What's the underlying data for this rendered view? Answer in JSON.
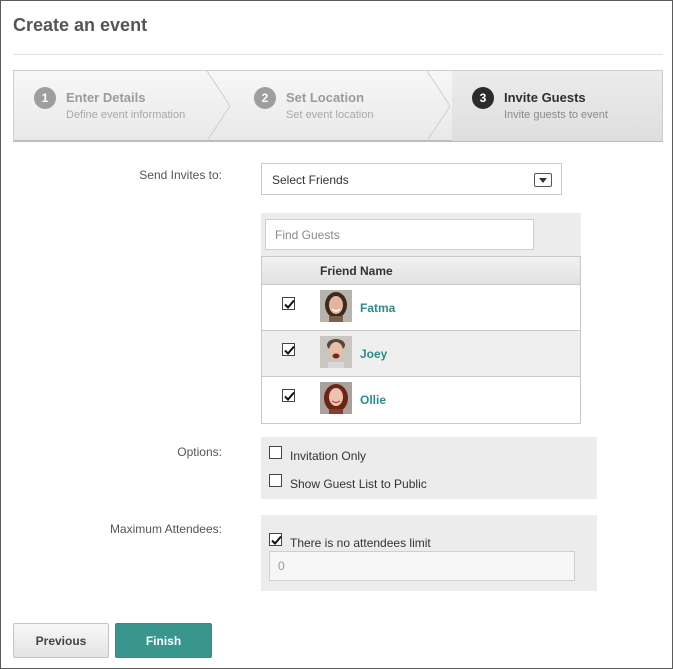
{
  "page": {
    "title": "Create an event"
  },
  "wizard": {
    "steps": [
      {
        "number": "1",
        "title": "Enter Details",
        "subtitle": "Define event information",
        "state": "inactive"
      },
      {
        "number": "2",
        "title": "Set Location",
        "subtitle": "Set event location",
        "state": "inactive"
      },
      {
        "number": "3",
        "title": "Invite Guests",
        "subtitle": "Invite guests to event",
        "state": "active"
      }
    ]
  },
  "invites": {
    "label": "Send Invites to:",
    "select_value": "Select Friends",
    "search_placeholder": "Find Guests",
    "column_header": "Friend Name",
    "friends": [
      {
        "name": "Fatma",
        "checked": true
      },
      {
        "name": "Joey",
        "checked": true
      },
      {
        "name": "Ollie",
        "checked": true
      }
    ]
  },
  "options": {
    "label": "Options:",
    "items": [
      {
        "label": "Invitation Only",
        "checked": false
      },
      {
        "label": "Show Guest List to Public",
        "checked": false
      }
    ]
  },
  "max_attendees": {
    "label": "Maximum Attendees:",
    "no_limit_label": "There is no attendees limit",
    "no_limit_checked": true,
    "value": "0"
  },
  "actions": {
    "previous_label": "Previous",
    "finish_label": "Finish"
  },
  "colors": {
    "accent": "#38968f",
    "link": "#2e8b8b",
    "active_step": "#2b2b2b"
  }
}
